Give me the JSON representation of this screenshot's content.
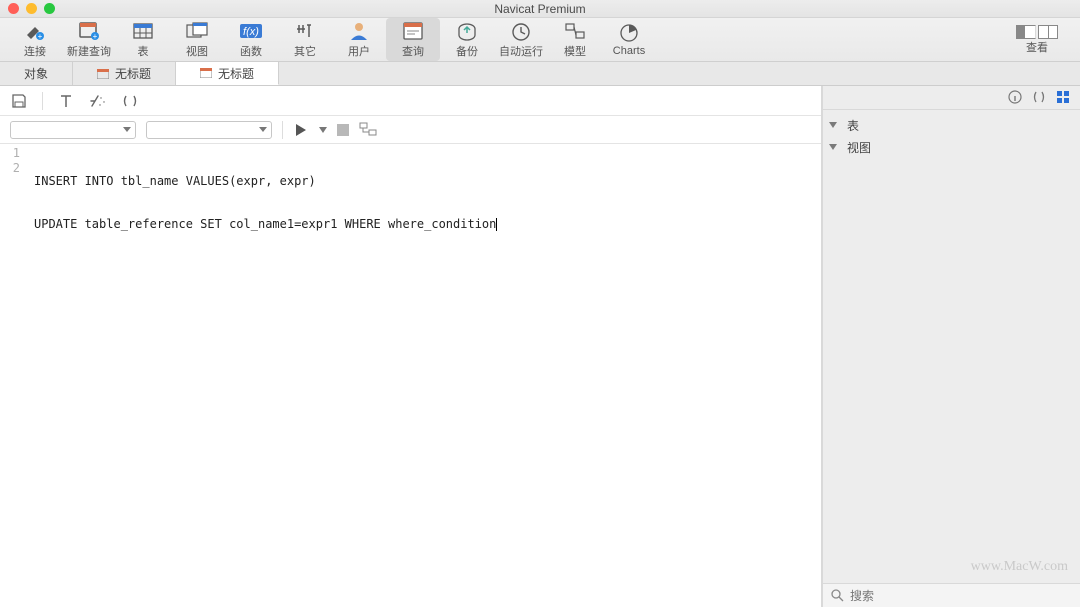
{
  "window": {
    "title": "Navicat Premium"
  },
  "toolbar": {
    "items": [
      {
        "label": "连接"
      },
      {
        "label": "新建查询"
      },
      {
        "label": "表"
      },
      {
        "label": "视图"
      },
      {
        "label": "函数"
      },
      {
        "label": "其它"
      },
      {
        "label": "用户"
      },
      {
        "label": "查询"
      },
      {
        "label": "备份"
      },
      {
        "label": "自动运行"
      },
      {
        "label": "模型"
      },
      {
        "label": "Charts"
      }
    ],
    "view_label": "查看"
  },
  "tabs": {
    "items": [
      {
        "label": "对象"
      },
      {
        "label": "无标题"
      },
      {
        "label": "无标题",
        "active": true
      }
    ]
  },
  "sidebar": {
    "items": [
      {
        "label": "表"
      },
      {
        "label": "视图"
      }
    ],
    "search_placeholder": "搜索"
  },
  "editor": {
    "lines": [
      "INSERT INTO tbl_name VALUES(expr, expr)",
      "UPDATE table_reference SET col_name1=expr1 WHERE where_condition"
    ]
  },
  "watermark": "www.MacW.com"
}
